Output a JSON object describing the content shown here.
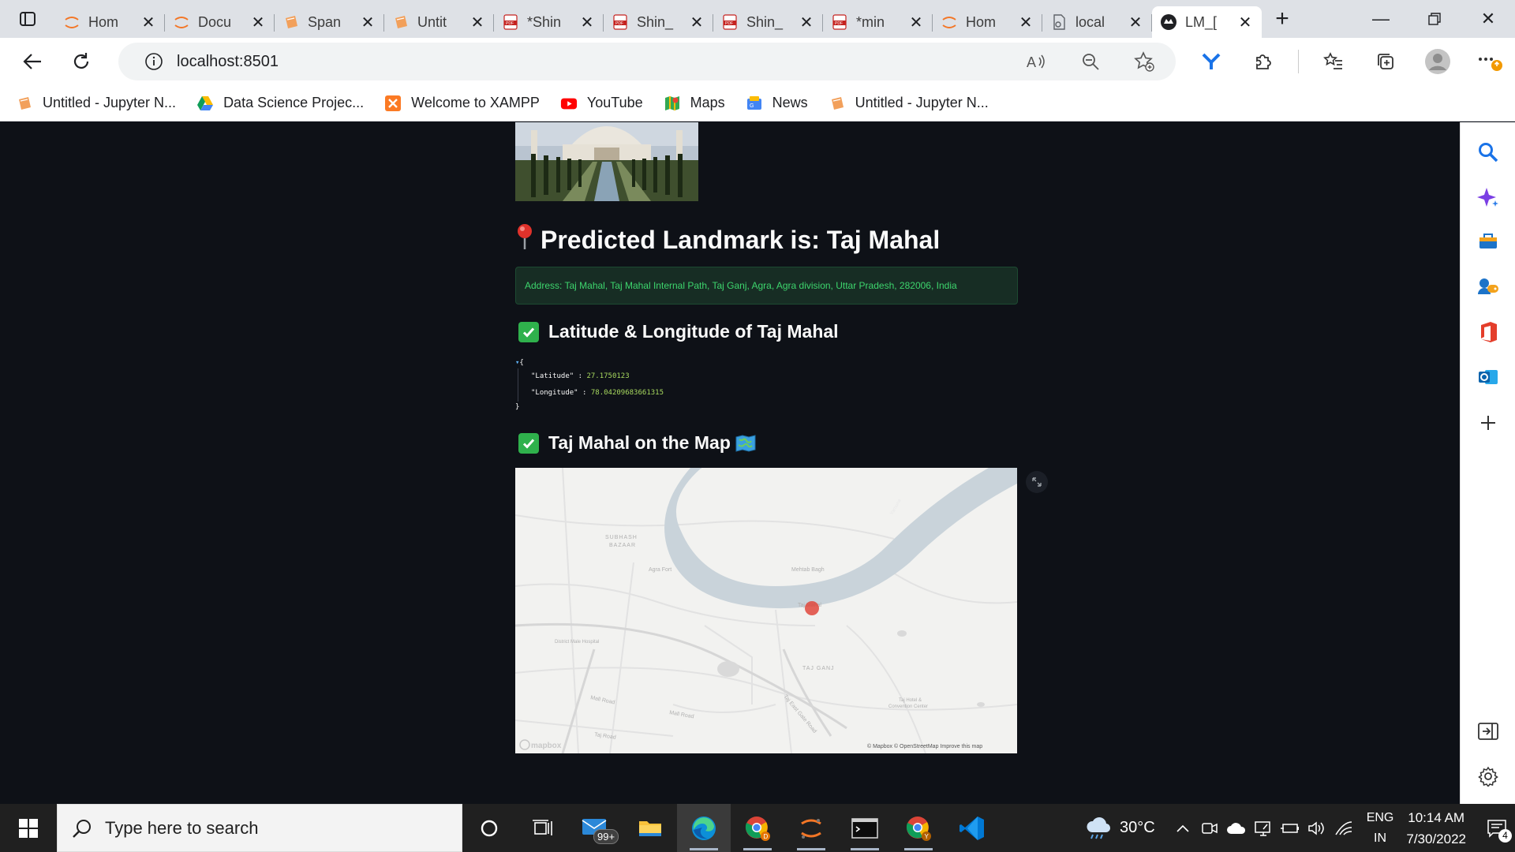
{
  "browser": {
    "tabs": [
      {
        "label": "Hom",
        "icon": "jupyter-icon"
      },
      {
        "label": "Docu",
        "icon": "jupyter-icon"
      },
      {
        "label": "Span",
        "icon": "notebook-icon"
      },
      {
        "label": "Untit",
        "icon": "notebook-icon"
      },
      {
        "label": "*Shin",
        "icon": "pdf-icon"
      },
      {
        "label": "Shin_",
        "icon": "pdf-icon"
      },
      {
        "label": "Shin_",
        "icon": "pdf-icon"
      },
      {
        "label": "*min",
        "icon": "pdf-icon"
      },
      {
        "label": "Hom",
        "icon": "jupyter-icon"
      },
      {
        "label": "local",
        "icon": "page-icon"
      },
      {
        "label": "LM_[",
        "icon": "streamlit-icon",
        "active": true
      }
    ],
    "url": "localhost:8501",
    "bookmarks": [
      {
        "label": "Untitled - Jupyter N...",
        "icon": "notebook-icon"
      },
      {
        "label": "Data Science Projec...",
        "icon": "drive-icon"
      },
      {
        "label": "Welcome to XAMPP",
        "icon": "xampp-icon"
      },
      {
        "label": "YouTube",
        "icon": "youtube-icon"
      },
      {
        "label": "Maps",
        "icon": "maps-icon"
      },
      {
        "label": "News",
        "icon": "news-icon"
      },
      {
        "label": "Untitled - Jupyter N...",
        "icon": "notebook-icon"
      }
    ]
  },
  "page": {
    "title_prefix": "Predicted Landmark is: ",
    "landmark": "Taj Mahal",
    "address": "Address: Taj Mahal, Taj Mahal Internal Path, Taj Ganj, Agra, Agra division, Uttar Pradesh, 282006, India",
    "latlon_heading": "Latitude & Longitude of Taj Mahal",
    "json": {
      "open": "{",
      "close": "}",
      "lat_key": "\"Latitude\"",
      "lat_value": "27.1750123",
      "lon_key": "\"Longitude\"",
      "lon_value": "78.04209683661315"
    },
    "map_heading": "Taj Mahal on the Map",
    "map": {
      "labels": [
        "SUBHASH",
        "BAZAAR",
        "Agra Fort",
        "Mehtab Bagh",
        "Taj Mahal",
        "District Male Hospital",
        "TAJ GANJ",
        "Mall Road",
        "Mall Road",
        "Taj Hotel &",
        "Convention Center",
        "Taj Road",
        "Taj East Gate Road",
        "Yamuna"
      ],
      "attribution": "© Mapbox © OpenStreetMap  Improve this map",
      "logo": "mapbox"
    }
  },
  "taskbar": {
    "search_placeholder": "Type here to search",
    "mail_badge": "99+",
    "weather": "30°C",
    "lang_top": "ENG",
    "lang_bottom": "IN",
    "time": "10:14 AM",
    "date": "7/30/2022",
    "notifications": "4"
  }
}
